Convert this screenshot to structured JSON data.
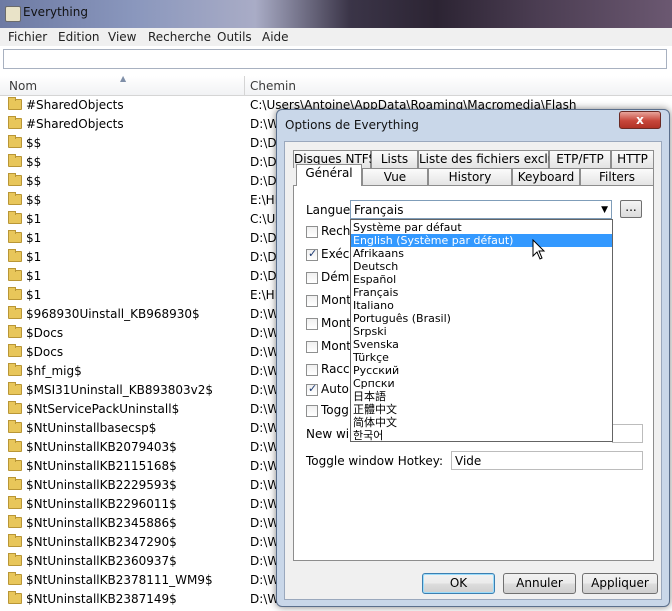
{
  "window": {
    "title": "Everything"
  },
  "menu": [
    "Fichier",
    "Edition",
    "View",
    "Recherche",
    "Outils",
    "Aide"
  ],
  "search": {
    "value": ""
  },
  "columns": {
    "name": "Nom",
    "path": "Chemin"
  },
  "files": [
    {
      "name": "#SharedObjects",
      "path": "C:\\Users\\Antoine\\AppData\\Roaming\\Macromedia\\Flash Player"
    },
    {
      "name": "#SharedObjects",
      "path": "D:\\W"
    },
    {
      "name": "$$",
      "path": "D:\\Do"
    },
    {
      "name": "$$",
      "path": "D:\\Do"
    },
    {
      "name": "$$",
      "path": "D:\\Do"
    },
    {
      "name": "$$",
      "path": "E:\\HD"
    },
    {
      "name": "$1",
      "path": "C:\\Us"
    },
    {
      "name": "$1",
      "path": "D:\\Do"
    },
    {
      "name": "$1",
      "path": "D:\\Do"
    },
    {
      "name": "$1",
      "path": "D:\\Do"
    },
    {
      "name": "$1",
      "path": "E:\\HD"
    },
    {
      "name": "$968930Uinstall_KB968930$",
      "path": "D:\\Wi"
    },
    {
      "name": "$Docs",
      "path": "D:\\W"
    },
    {
      "name": "$Docs",
      "path": "D:\\W"
    },
    {
      "name": "$hf_mig$",
      "path": "D:\\W"
    },
    {
      "name": "$MSI31Uninstall_KB893803v2$",
      "path": "D:\\W"
    },
    {
      "name": "$NtServicePackUninstall$",
      "path": "D:\\W"
    },
    {
      "name": "$NtUninstallbasecsp$",
      "path": "D:\\W"
    },
    {
      "name": "$NtUninstallKB2079403$",
      "path": "D:\\W"
    },
    {
      "name": "$NtUninstallKB2115168$",
      "path": "D:\\W"
    },
    {
      "name": "$NtUninstallKB2229593$",
      "path": "D:\\W"
    },
    {
      "name": "$NtUninstallKB2296011$",
      "path": "D:\\W"
    },
    {
      "name": "$NtUninstallKB2345886$",
      "path": "D:\\W"
    },
    {
      "name": "$NtUninstallKB2347290$",
      "path": "D:\\W"
    },
    {
      "name": "$NtUninstallKB2360937$",
      "path": "D:\\W"
    },
    {
      "name": "$NtUninstallKB2378111_WM9$",
      "path": "D:\\W"
    },
    {
      "name": "$NtUninstallKB2387149$",
      "path": "D:\\W"
    }
  ],
  "dialog": {
    "title": "Options de Everything",
    "close": "x",
    "tabs_row1": [
      "Disques NTFS",
      "Lists",
      "Liste des fichiers exclus",
      "ETP/FTP",
      "HTTP"
    ],
    "tabs_row2": [
      "Général",
      "Vue",
      "History",
      "Keyboard",
      "Filters"
    ],
    "language_label": "Langue:",
    "language_value": "Français",
    "browse": "...",
    "language_options": [
      "Système par défaut",
      "English (Système par défaut)",
      "Afrikaans",
      "Deutsch",
      "Español",
      "Français",
      "Italiano",
      "Português (Brasil)",
      "Srpski",
      "Svenska",
      "Türkçe",
      "Русский",
      "Српски",
      "日本語",
      "正體中文",
      "简体中文",
      "한국어"
    ],
    "selected_option_index": 1,
    "checkboxes": [
      {
        "label": "Reche",
        "checked": false
      },
      {
        "label": "Exécu",
        "checked": true
      },
      {
        "label": "Démar",
        "checked": false
      },
      {
        "label": "Montre",
        "checked": false
      },
      {
        "label": "Montre",
        "checked": false
      },
      {
        "label": "Montre",
        "checked": false
      },
      {
        "label": "Racco",
        "checked": false
      },
      {
        "label": "Autoris",
        "checked": true
      },
      {
        "label": "Toggle",
        "checked": false
      }
    ],
    "new_window_label": "New windo",
    "toggle_hotkey_label": "Toggle window Hotkey:",
    "toggle_hotkey_value": "Vide",
    "ok": "OK",
    "cancel": "Annuler",
    "apply": "Appliquer"
  }
}
